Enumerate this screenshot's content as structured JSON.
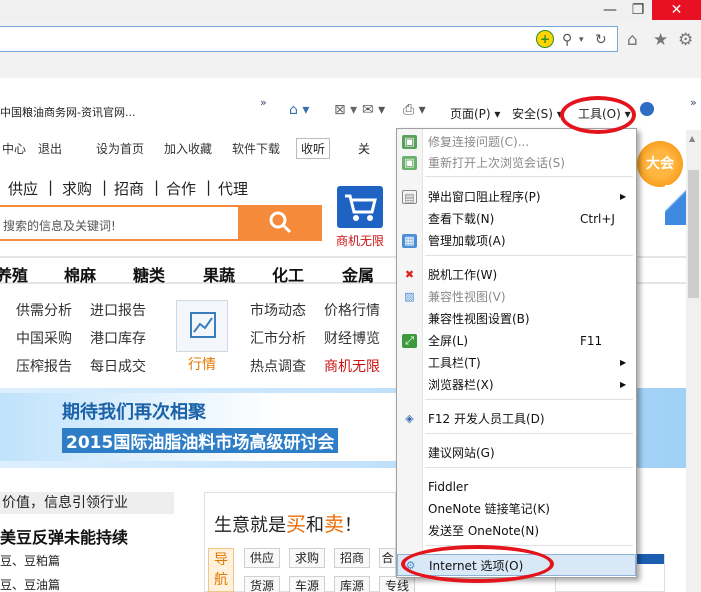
{
  "window": {
    "min_glyph": "—",
    "max_glyph": "❐",
    "close_glyph": "✕"
  },
  "addressbar": {
    "compat_glyph": "+",
    "search_glyph": "⚲",
    "dropdown_glyph": "▾",
    "refresh_glyph": "↻"
  },
  "toolbar_right": {
    "home_glyph": "⌂",
    "favorites_glyph": "★",
    "settings_glyph": "⚙"
  },
  "tab": {
    "title": "中国粮油商务网-资讯官网..."
  },
  "commandbar": {
    "chevron": "»",
    "home_glyph": "⌂ ▾",
    "rss_glyph": "⊠ ▾",
    "mail_glyph": "✉ ▾",
    "print_glyph": "⎙ ▾",
    "page_label": "页面(P) ▾",
    "safety_label": "安全(S) ▾",
    "tools_label": "工具(O) ▾"
  },
  "webpage": {
    "top_links": [
      "中心",
      "退出",
      "设为首页",
      "加入收藏",
      "软件下载"
    ],
    "collect_label": "收听",
    "weibo_label": "关",
    "category_nav": [
      "供应",
      "求购",
      "招商",
      "合作",
      "代理"
    ],
    "category_sep": "|",
    "search_placeholder": "搜索的信息及关键词!",
    "cart_label": "商机无限",
    "main_nav": [
      "养殖",
      "棉麻",
      "糖类",
      "果蔬",
      "化工",
      "金属"
    ],
    "biz_links_left": [
      "供需分析",
      "进口报告",
      "中国采购",
      "港口库存",
      "压榨报告",
      "每日成交"
    ],
    "hangqing_label": "行情",
    "biz_links_right": [
      "市场动态",
      "价格行情",
      "汇市分析",
      "财经博览",
      "热点调查",
      "商机无限"
    ],
    "banner_line1": "期待我们再次相聚",
    "banner_line2": "2015国际油脂油料市场高级研讨会",
    "slogan": "价值，信息引领行业",
    "news_headline": "美豆反弹未能持续",
    "news_items": [
      "豆、豆粕篇",
      "豆、豆油篇"
    ],
    "deal_title_pre": "生意就是",
    "deal_buy": "买",
    "deal_and": "和",
    "deal_sell": "卖",
    "deal_excl": "！",
    "side_tab": "导航",
    "deal_tags_row1": [
      "供应",
      "求购",
      "招商",
      "合"
    ],
    "deal_tags_row2": [
      "货源",
      "车源",
      "库源",
      "专线"
    ],
    "dahui_label": "大会"
  },
  "menu": {
    "items": [
      {
        "label": "修复连接问题(C)...",
        "disabled": true
      },
      {
        "label": "重新打开上次浏览会话(S)",
        "disabled": true
      },
      {
        "label": "弹出窗口阻止程序(P)",
        "arrow": "▶"
      },
      {
        "label": "查看下载(N)",
        "shortcut": "Ctrl+J"
      },
      {
        "label": "管理加载项(A)"
      },
      {
        "label": "脱机工作(W)"
      },
      {
        "label": "兼容性视图(V)",
        "disabled": true
      },
      {
        "label": "兼容性视图设置(B)"
      },
      {
        "label": "全屏(L)",
        "shortcut": "F11"
      },
      {
        "label": "工具栏(T)",
        "arrow": "▶"
      },
      {
        "label": "浏览器栏(X)",
        "arrow": "▶"
      },
      {
        "label": "F12 开发人员工具(D)"
      },
      {
        "label": "建议网站(G)"
      },
      {
        "label": "Fiddler"
      },
      {
        "label": "OneNote 链接笔记(K)"
      },
      {
        "label": "发送至 OneNote(N)"
      },
      {
        "label": "Internet 选项(O)"
      }
    ]
  },
  "colors": {
    "highlight_circle": "#e3141c",
    "search_orange": "#f58a3a",
    "brand_blue": "#1e63c4"
  }
}
